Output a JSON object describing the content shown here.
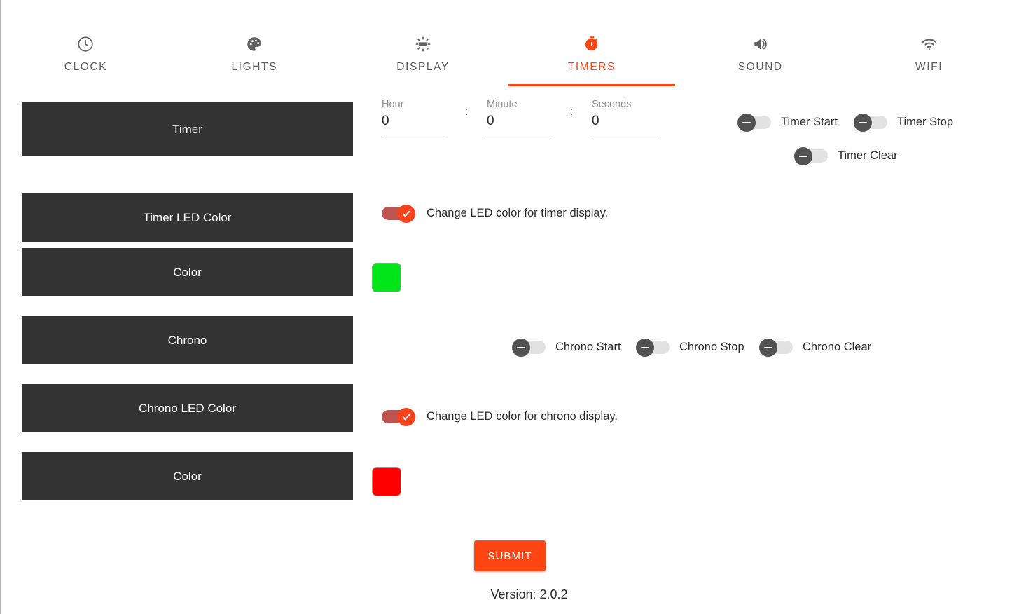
{
  "nav": {
    "tabs": [
      {
        "label": "CLOCK",
        "icon": "clock-icon",
        "active": false
      },
      {
        "label": "LIGHTS",
        "icon": "palette-icon",
        "active": false
      },
      {
        "label": "DISPLAY",
        "icon": "brightness-icon",
        "active": false
      },
      {
        "label": "TIMERS",
        "icon": "stopwatch-icon",
        "active": true
      },
      {
        "label": "SOUND",
        "icon": "speaker-icon",
        "active": false
      },
      {
        "label": "WIFI",
        "icon": "wifi-icon",
        "active": false
      }
    ],
    "active_color": "#ff4612",
    "inactive_color": "#5c5c5c"
  },
  "sections": {
    "timer_button": "Timer",
    "timer_led_color_button": "Timer LED Color",
    "timer_color_button": "Color",
    "chrono_button": "Chrono",
    "chrono_led_color_button": "Chrono LED Color",
    "chrono_color_button": "Color"
  },
  "timer_inputs": {
    "hour": {
      "label": "Hour",
      "value": "0"
    },
    "minute": {
      "label": "Minute",
      "value": "0"
    },
    "seconds": {
      "label": "Seconds",
      "value": "0"
    },
    "separator": ":"
  },
  "timer_switches": [
    {
      "label": "Timer Start",
      "state": "off"
    },
    {
      "label": "Timer Stop",
      "state": "off"
    },
    {
      "label": "Timer Clear",
      "state": "off"
    }
  ],
  "chrono_switches": [
    {
      "label": "Chrono Start",
      "state": "off"
    },
    {
      "label": "Chrono Stop",
      "state": "off"
    },
    {
      "label": "Chrono Clear",
      "state": "off"
    }
  ],
  "led_toggles": {
    "timer": {
      "label": "Change LED color for timer display.",
      "state": "on"
    },
    "chrono": {
      "label": "Change LED color for chrono display.",
      "state": "on"
    }
  },
  "color_swatches": {
    "timer_color": "#00e619",
    "chrono_color": "#ff0000"
  },
  "footer": {
    "submit_label": "SUBMIT",
    "version": "Version: 2.0.2"
  },
  "theme": {
    "accent": "#ff4612",
    "button_dark": "#333333",
    "switch_on_track": "#bd5450",
    "switch_on_thumb": "#f4441d",
    "switch_off_track": "#e2e2e2",
    "switch_off_thumb": "#525252"
  }
}
